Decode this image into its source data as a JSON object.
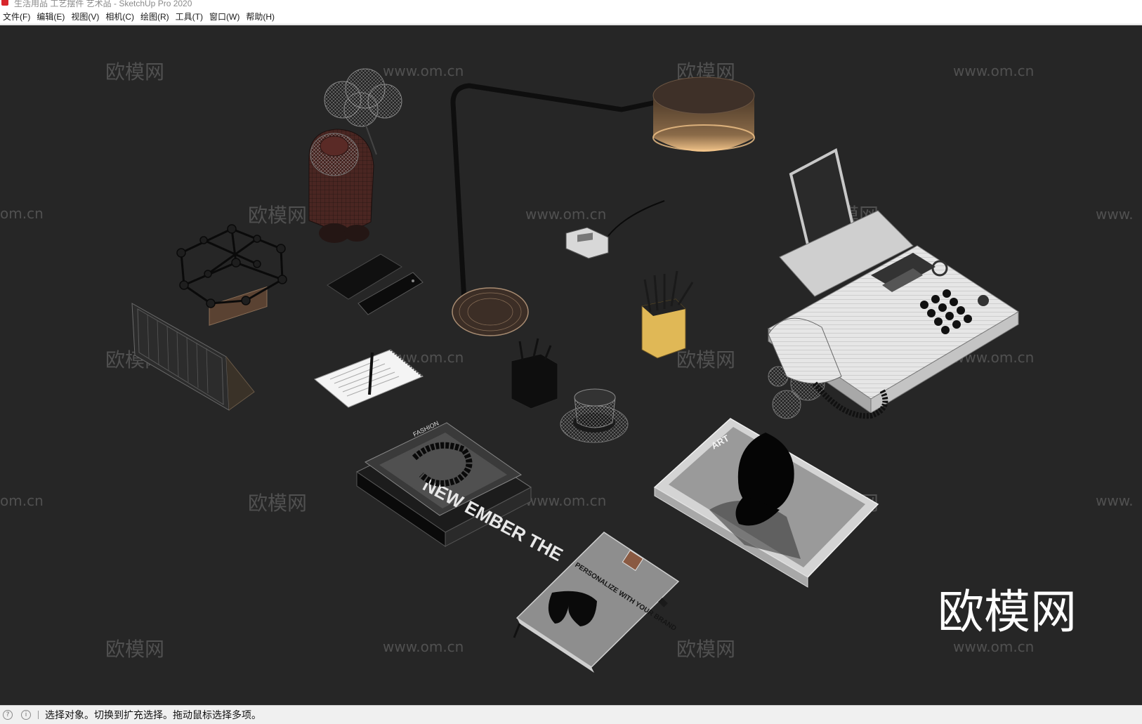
{
  "window": {
    "title": "生活用品 工艺摆件 艺术品 - SketchUp Pro 2020"
  },
  "menu": {
    "items": [
      {
        "label": "文件(F)",
        "key": "file"
      },
      {
        "label": "编辑(E)",
        "key": "edit"
      },
      {
        "label": "视图(V)",
        "key": "view"
      },
      {
        "label": "相机(C)",
        "key": "camera"
      },
      {
        "label": "绘图(R)",
        "key": "draw"
      },
      {
        "label": "工具(T)",
        "key": "tools"
      },
      {
        "label": "窗口(W)",
        "key": "window"
      },
      {
        "label": "帮助(H)",
        "key": "help"
      }
    ]
  },
  "viewport": {
    "background_color": "#262626",
    "watermark_brand": "欧模网",
    "watermark_url": "www.om.cn",
    "watermark_url_partial": "om.cn",
    "watermark_url_prefix": "www.",
    "large_logo": "欧模网",
    "book_titles": {
      "fashion_book_cover": "FASHION",
      "fashion_book_title": "NEW EMBER THE",
      "notebook_cover": "PERSONALIZE WITH YOUR BRAND",
      "art_book_label": "ART"
    }
  },
  "statusbar": {
    "icon1": "geo-location-icon",
    "icon2": "info-icon",
    "message": "选择对象。切换到扩充选择。拖动鼠标选择多项。"
  },
  "colors": {
    "app_red": "#d8262c",
    "lamp_glow": "#f2c48a",
    "pencil_cup": "#e8c25a",
    "watermark": "#5a5a5a"
  }
}
